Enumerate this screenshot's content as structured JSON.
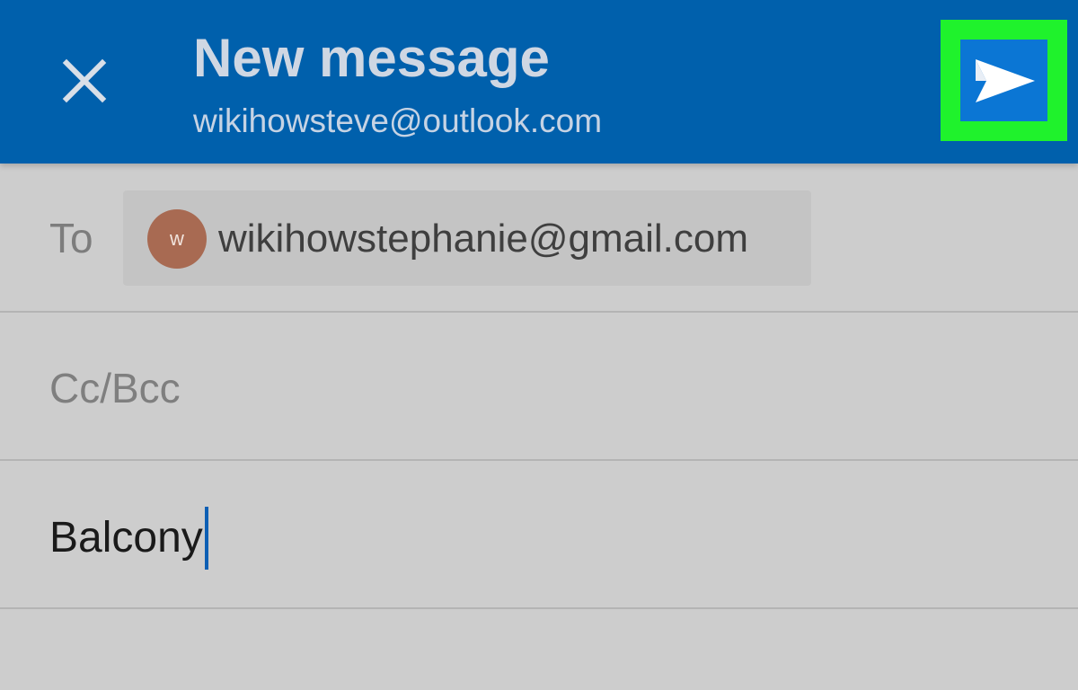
{
  "header": {
    "title": "New message",
    "account": "wikihowsteve@outlook.com",
    "close_icon": "close-icon",
    "send_icon": "send-icon",
    "colors": {
      "header_bg": "#0060ac",
      "send_bg": "#0b76d4",
      "highlight": "#1ff22c"
    }
  },
  "to": {
    "label": "To",
    "recipient": {
      "initial": "w",
      "email": "wikihowstephanie@gmail.com",
      "avatar_color": "#a86a52"
    }
  },
  "cc": {
    "label": "Cc/Bcc"
  },
  "subject": {
    "value": "Balcony"
  }
}
